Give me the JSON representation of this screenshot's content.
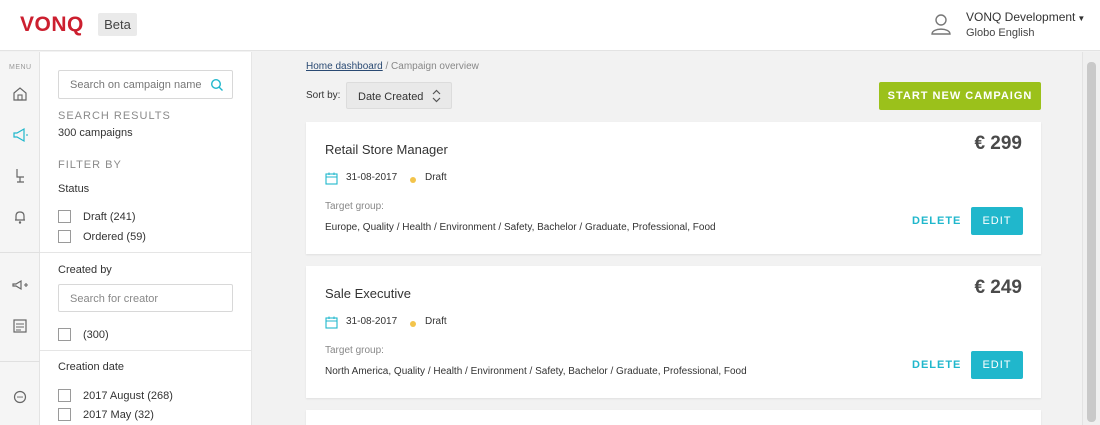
{
  "header": {
    "logo": "VONQ",
    "badge": "Beta",
    "user_name": "VONQ Development",
    "user_org": "Globo English"
  },
  "rail": {
    "menu_label": "MENU",
    "icons": [
      "home-icon",
      "megaphone-icon",
      "chair-icon",
      "bell-icon",
      "campaign-add-icon",
      "document-icon",
      "chat-icon"
    ]
  },
  "filters": {
    "search_placeholder": "Search on campaign name",
    "results_title": "SEARCH RESULTS",
    "results_count": "300 campaigns",
    "filter_by": "FILTER BY",
    "status_title": "Status",
    "status_options": [
      "Draft (241)",
      "Ordered (59)"
    ],
    "created_by_title": "Created by",
    "creator_placeholder": "Search for creator",
    "creator_options": [
      "(300)"
    ],
    "creation_date_title": "Creation date",
    "date_options": [
      "2017 August (268)",
      "2017 May (32)"
    ]
  },
  "main": {
    "breadcrumb_home": "Home dashboard",
    "breadcrumb_current": "/ Campaign overview",
    "sort_label": "Sort by:",
    "sort_value": "Date Created",
    "start_button": "START NEW CAMPAIGN"
  },
  "campaigns": [
    {
      "title": "Retail Store Manager",
      "price": "€ 299",
      "date": "31-08-2017",
      "status": "Draft",
      "target_label": "Target group:",
      "target_value": "Europe, Quality / Health / Environment / Safety, Bachelor / Graduate, Professional, Food",
      "delete": "DELETE",
      "edit": "EDIT"
    },
    {
      "title": "Sale Executive",
      "price": "€ 249",
      "date": "31-08-2017",
      "status": "Draft",
      "target_label": "Target group:",
      "target_value": "North America, Quality / Health / Environment / Safety, Bachelor / Graduate, Professional, Food",
      "delete": "DELETE",
      "edit": "EDIT"
    }
  ],
  "colors": {
    "brand": "#cc1f2f",
    "primary_action": "#9bc11b",
    "accent": "#20b7cc",
    "draft_dot": "#f3c44b"
  }
}
